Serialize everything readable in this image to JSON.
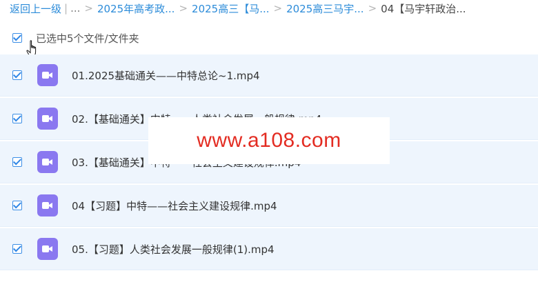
{
  "breadcrumb": {
    "back": "返回上一级",
    "divider": "|",
    "ellipsis": "...",
    "items": [
      "2025年高考政...",
      "2025高三【马...",
      "2025高三马宇..."
    ],
    "current": "04【马宇轩政治..."
  },
  "selection": {
    "label": "已选中5个文件/文件夹"
  },
  "files": [
    {
      "name": "01.2025基础通关——中特总论~1.mp4"
    },
    {
      "name": "02.【基础通关】中特——人类社会发展一般规律.mp4"
    },
    {
      "name": "03.【基础通关】中特——社会主义建设规律.mp4"
    },
    {
      "name": "04【习题】中特——社会主义建设规律.mp4"
    },
    {
      "name": "05.【习题】人类社会发展一般规律(1).mp4"
    }
  ],
  "watermark": {
    "text": "www.a108.com"
  },
  "icons": {
    "file": "video-file-icon",
    "cursor": "hand-pointer-icon"
  },
  "colors": {
    "link": "#2b8bd9",
    "row_bg": "#eef5fd",
    "file_icon": "#8a78f0",
    "watermark": "#e32c22"
  }
}
